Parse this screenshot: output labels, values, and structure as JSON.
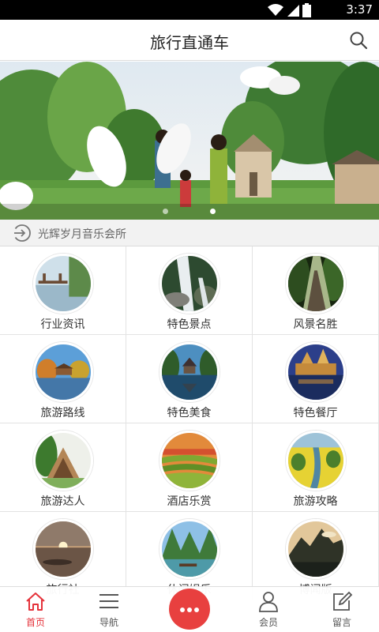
{
  "status_bar": {
    "time": "3:37",
    "battery_level": "2",
    "icons": [
      "wifi-icon",
      "signal-icon",
      "battery-icon"
    ]
  },
  "header": {
    "title": "旅行直通车",
    "search_icon": "search-icon"
  },
  "banner": {
    "description_icon": "banner-photo",
    "dot_count": 2,
    "active_dot": 1
  },
  "notice": {
    "text": "光辉岁月音乐会所",
    "icon": "login-arrow-icon"
  },
  "grid": {
    "items": [
      {
        "label": "行业资讯",
        "photo": "lake-pier"
      },
      {
        "label": "特色景点",
        "photo": "waterfall"
      },
      {
        "label": "风景名胜",
        "photo": "forest-rail"
      },
      {
        "label": "旅游路线",
        "photo": "autumn-lake"
      },
      {
        "label": "特色美食",
        "photo": "pagoda-reflection"
      },
      {
        "label": "特色餐厅",
        "photo": "night-castle"
      },
      {
        "label": "旅游达人",
        "photo": "a-frame-huts"
      },
      {
        "label": "酒店乐赏",
        "photo": "rice-terraces"
      },
      {
        "label": "旅游攻略",
        "photo": "flower-river"
      },
      {
        "label": "旅行社",
        "photo": "sunset-lake"
      },
      {
        "label": "休闲娱乐",
        "photo": "karst-river"
      },
      {
        "label": "博闻版",
        "photo": "mountain-dusk"
      }
    ]
  },
  "tabbar": {
    "tabs": [
      {
        "label": "首页",
        "icon": "home-icon",
        "active": true
      },
      {
        "label": "导航",
        "icon": "menu-icon",
        "active": false
      },
      {
        "label": "会员",
        "icon": "user-icon",
        "active": false
      },
      {
        "label": "留言",
        "icon": "edit-icon",
        "active": false
      }
    ],
    "center_icon": "more-dots-icon"
  },
  "colors": {
    "accent": "#e5323a",
    "center_button": "#e8403f",
    "status_bar": "#000000",
    "notice_bg": "#f2f2f2"
  }
}
